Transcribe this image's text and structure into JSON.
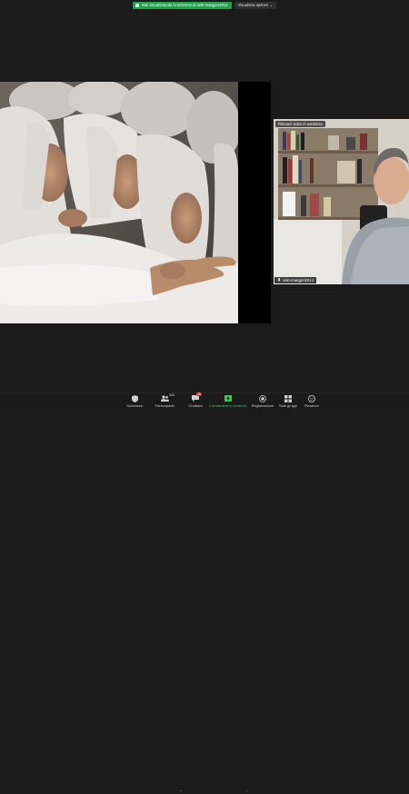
{
  "banner": {
    "share_notice": "Stai visualizzando lo schermo di vekt-marqpro2014",
    "view_options": "Visualizza opzioni"
  },
  "participant": {
    "tile_label": "Rimuovi video in evidenza",
    "name": "vekt-marqpro2014"
  },
  "toolbar": {
    "security": "Sicurezza",
    "participants": "Partecipanti",
    "participants_count": "340",
    "chat": "Chattare",
    "chat_badge": "39",
    "share": "Condividere lo schermo",
    "record": "Registrazione",
    "breakout": "Sale gruppi",
    "reactions": "Reazioni"
  },
  "colors": {
    "share_green": "#1fa34a",
    "toolbar_bg": "#1a1a1a",
    "page_bg": "#1b1b1b"
  }
}
